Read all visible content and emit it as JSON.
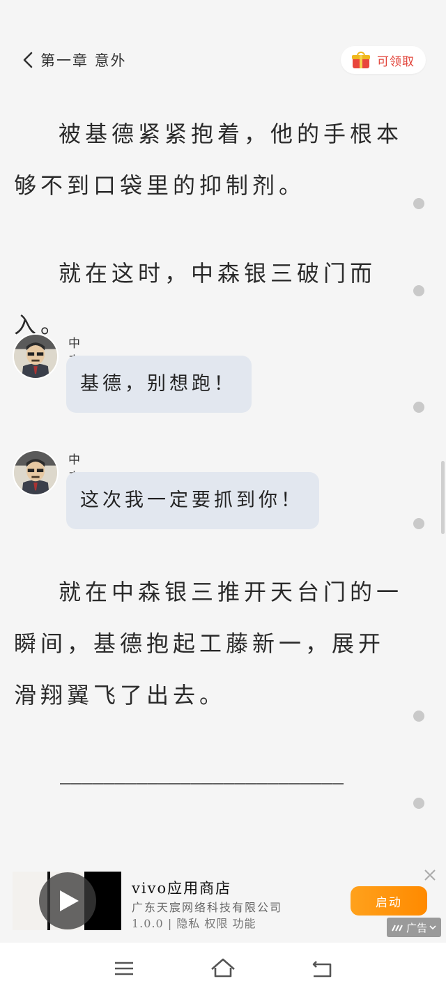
{
  "header": {
    "back_icon": "chevron-left-icon",
    "chapter_title": "第一章 意外",
    "reward_label": "可领取",
    "reward_icon": "gift-icon"
  },
  "content": {
    "paragraph_1": "被基德紧紧抱着，他的手根本够不到口袋里的抑制剂。",
    "paragraph_2": "就在这时，中森银三破门而入。",
    "chats": [
      {
        "speaker": "中森银三",
        "text": "基德，别想跑！"
      },
      {
        "speaker": "中森银三",
        "text": "这次我一定要抓到你！"
      }
    ],
    "paragraph_3": "就在中森银三推开天台门的一瞬间，基德抱起工藤新一，展开滑翔翼飞了出去。",
    "separator": "——————————————————————————"
  },
  "ad": {
    "title": "vivo应用商店",
    "company": "广东天宸网络科技有限公司",
    "version": "1.0.0",
    "divider": "|",
    "links": [
      "隐私",
      "权限",
      "功能"
    ],
    "launch_label": "启动",
    "badge_label": "广告",
    "colors": {
      "launch_button": "#ff9a12"
    }
  },
  "navbar": {
    "menu_icon": "menu-icon",
    "home_icon": "home-icon",
    "back_icon": "back-icon"
  }
}
